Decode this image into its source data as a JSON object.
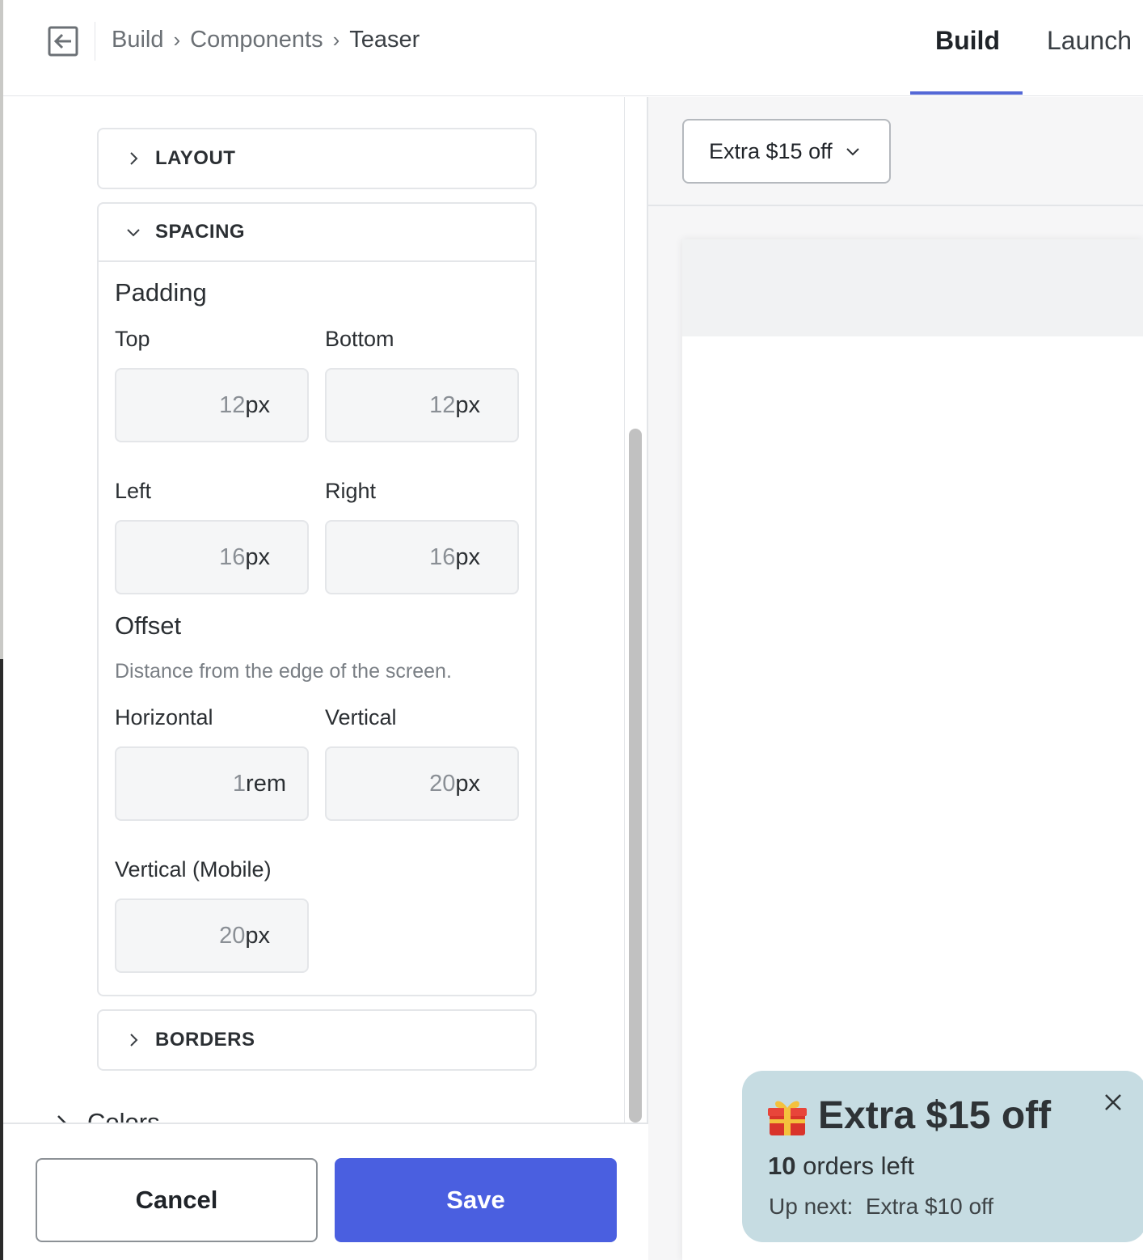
{
  "header": {
    "breadcrumb": [
      "Build",
      "Components",
      "Teaser"
    ],
    "breadcrumb_separator": "›",
    "tabs": [
      {
        "label": "Build",
        "active": true
      },
      {
        "label": "Launch",
        "active": false
      }
    ],
    "accent_color": "#5468d6"
  },
  "sections": {
    "layout_label": "LAYOUT",
    "spacing_label": "SPACING",
    "borders_label": "BORDERS",
    "colors_label": "Colors"
  },
  "spacing": {
    "padding_title": "Padding",
    "top": {
      "label": "Top",
      "value": "12",
      "unit": "px"
    },
    "bottom": {
      "label": "Bottom",
      "value": "12",
      "unit": "px"
    },
    "left": {
      "label": "Left",
      "value": "16",
      "unit": "px"
    },
    "right": {
      "label": "Right",
      "value": "16",
      "unit": "px"
    },
    "offset_title": "Offset",
    "offset_help": "Distance from the edge of the screen.",
    "horizontal": {
      "label": "Horizontal",
      "value": "1",
      "unit": "rem"
    },
    "vertical": {
      "label": "Vertical",
      "value": "20",
      "unit": "px"
    },
    "vertical_mobile": {
      "label": "Vertical (Mobile)",
      "value": "20",
      "unit": "px"
    }
  },
  "footer": {
    "cancel_label": "Cancel",
    "save_label": "Save",
    "save_color": "#4a5fe0"
  },
  "preview": {
    "variant_selected": "Extra $15 off",
    "teaser": {
      "icon": "gift-icon",
      "headline": "Extra $15 off",
      "orders_count": "10",
      "orders_text": " orders left",
      "up_next": "Up next:  Extra $10 off",
      "background": "#c6dce2"
    }
  }
}
